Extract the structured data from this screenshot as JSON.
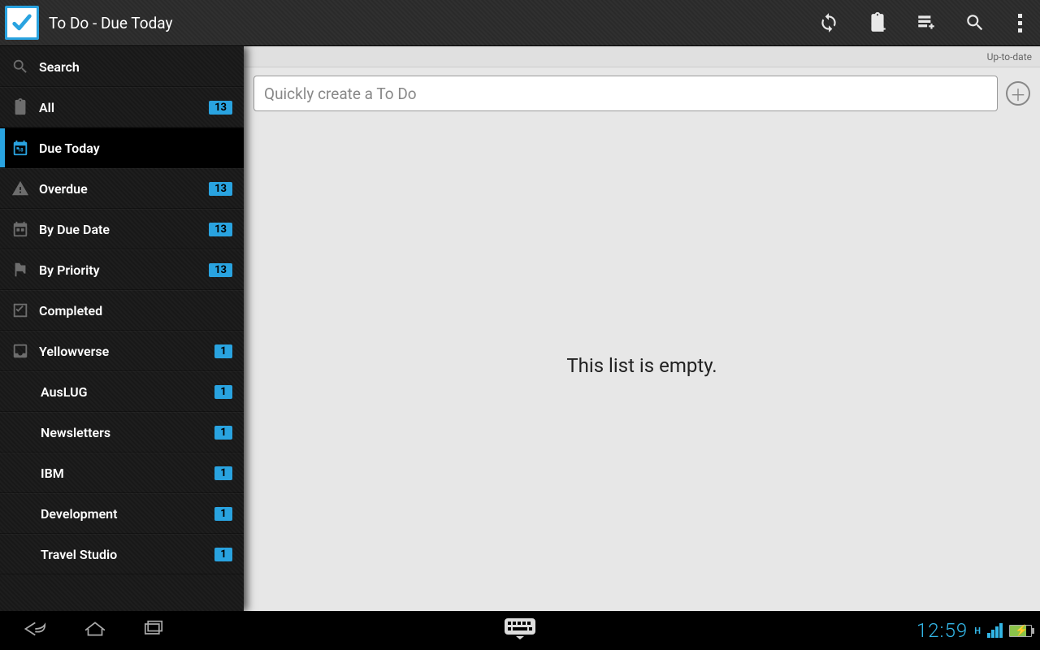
{
  "header": {
    "title": "To Do - Due Today"
  },
  "sidebar": {
    "search_label": "Search",
    "items": [
      {
        "icon": "clipboard",
        "label": "All",
        "badge": "13",
        "active": false
      },
      {
        "icon": "calendar",
        "label": "Due Today",
        "badge": null,
        "active": true
      },
      {
        "icon": "warning",
        "label": "Overdue",
        "badge": "13",
        "active": false
      },
      {
        "icon": "grid",
        "label": "By Due Date",
        "badge": "13",
        "active": false
      },
      {
        "icon": "flag",
        "label": "By Priority",
        "badge": "13",
        "active": false
      },
      {
        "icon": "check",
        "label": "Completed",
        "badge": null,
        "active": false
      },
      {
        "icon": "inbox",
        "label": "Yellowverse",
        "badge": "1",
        "active": false
      }
    ],
    "sub_items": [
      {
        "label": "AusLUG",
        "badge": "1"
      },
      {
        "label": "Newsletters",
        "badge": "1"
      },
      {
        "label": "IBM",
        "badge": "1"
      },
      {
        "label": "Development",
        "badge": "1"
      },
      {
        "label": "Travel Studio",
        "badge": "1"
      }
    ]
  },
  "main": {
    "sync_status": "Up-to-date",
    "quick_add_placeholder": "Quickly create a To Do",
    "empty_text": "This list is empty."
  },
  "system": {
    "clock": "12:59",
    "network_indicator": "H"
  }
}
